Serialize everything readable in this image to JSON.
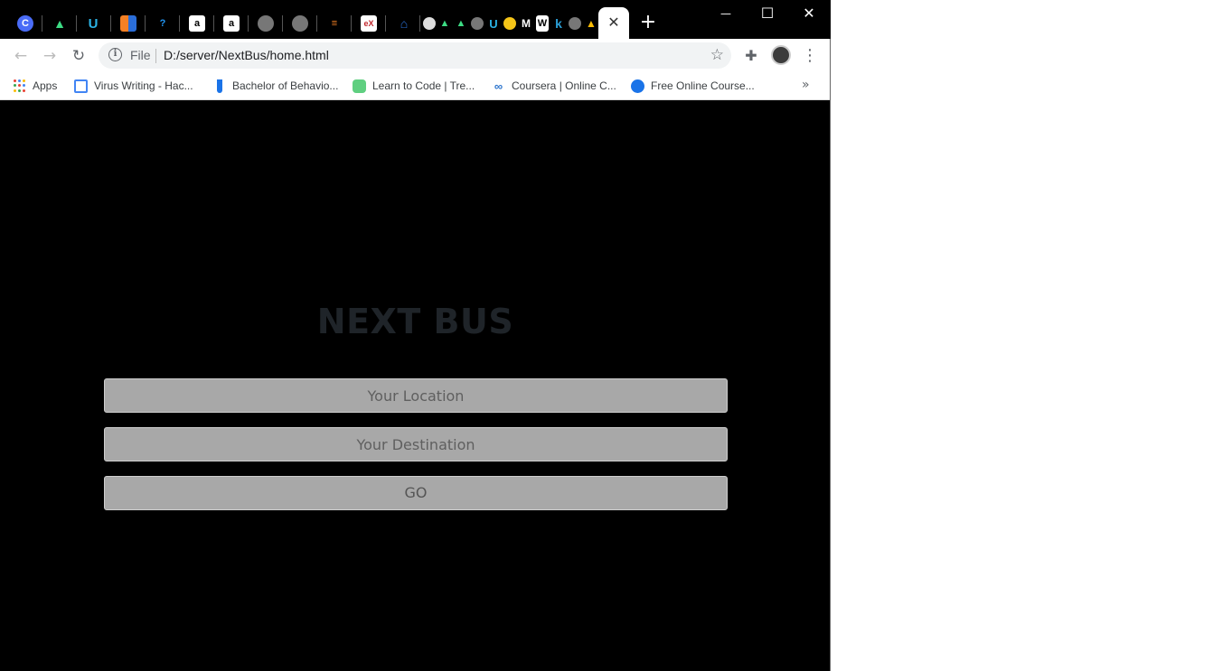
{
  "browser": {
    "tabs": [
      {
        "icon": "c-logo-icon",
        "color": "#4a6cf7",
        "glyph": "C"
      },
      {
        "icon": "android-icon",
        "color": "#3ddc84",
        "glyph": "▲"
      },
      {
        "icon": "u-logo-icon",
        "color": "#2bb3e5",
        "glyph": "U"
      },
      {
        "icon": "stackoverflow-like-icon",
        "color": "#f48024",
        "glyph": "▮"
      },
      {
        "icon": "question-icon",
        "color": "#2196f3",
        "glyph": "?"
      },
      {
        "icon": "amazon-icon",
        "color": "#ffffff",
        "glyph": "a"
      },
      {
        "icon": "amazon-icon",
        "color": "#ffffff",
        "glyph": "a"
      },
      {
        "icon": "globe-icon",
        "color": "#888888",
        "glyph": "◉"
      },
      {
        "icon": "globe-icon",
        "color": "#888888",
        "glyph": "◉"
      },
      {
        "icon": "stackoverflow-icon",
        "color": "#f48024",
        "glyph": "≡"
      },
      {
        "icon": "edx-icon",
        "color": "#ffffff",
        "glyph": "eX"
      },
      {
        "icon": "house-icon",
        "color": "#2a6fd6",
        "glyph": "⌂"
      }
    ],
    "active_tab_close": "✕",
    "new_tab": "+",
    "window_controls": {
      "minimize": "—",
      "maximize": "☐",
      "close": "✕"
    },
    "toolbar": {
      "back": "←",
      "forward": "→",
      "reload": "↻",
      "scheme_label": "File",
      "url": "D:/server/NextBus/home.html",
      "star": "☆",
      "extensions": "✚",
      "menu": "⋮"
    },
    "bookmarks": [
      {
        "label": "Apps",
        "icon": "apps-grid-icon",
        "color": "#4285f4"
      },
      {
        "label": "Virus Writing - Hac...",
        "icon": "page-icon",
        "color": "#4285f4"
      },
      {
        "label": "Bachelor of Behavio...",
        "icon": "test-tube-icon",
        "color": "#1a73e8"
      },
      {
        "label": "Learn to Code | Tre...",
        "icon": "treehouse-icon",
        "color": "#5fcf80"
      },
      {
        "label": "Coursera | Online C...",
        "icon": "coursera-icon",
        "color": "#2a73cc"
      },
      {
        "label": "Free Online Course...",
        "icon": "globe-icon",
        "color": "#1a73e8"
      }
    ],
    "bookmarks_more": "»"
  },
  "page": {
    "title": "NEXT BUS",
    "location_placeholder": "Your Location",
    "destination_placeholder": "Your Destination",
    "go_label": "GO"
  }
}
